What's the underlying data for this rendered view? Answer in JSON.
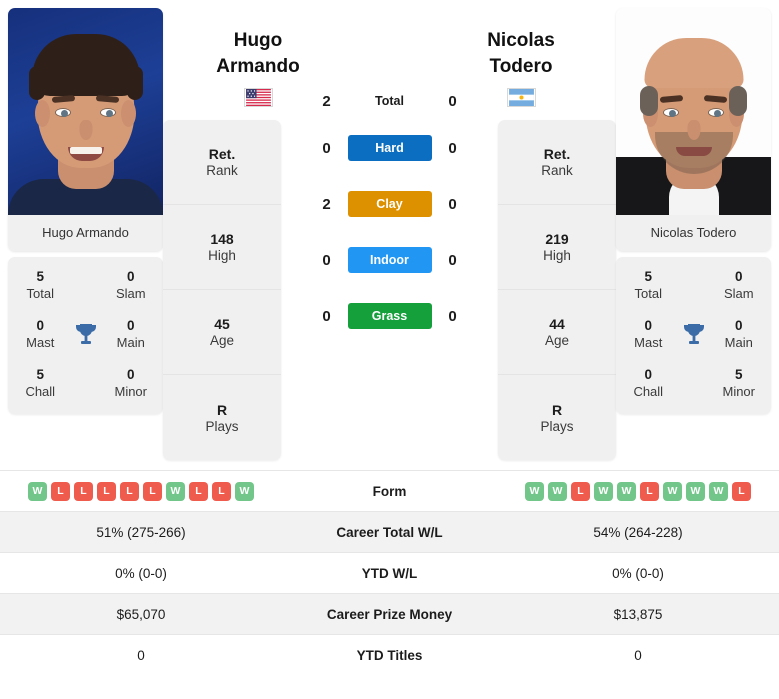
{
  "players": {
    "left": {
      "first_name": "Hugo",
      "last_name": "Armando",
      "full_name": "Hugo Armando",
      "flag": "us-flag-icon",
      "photo_name": "Hugo Armando",
      "rank": "Ret.",
      "rank_label": "Rank",
      "high": "148",
      "high_label": "High",
      "age": "45",
      "age_label": "Age",
      "plays": "R",
      "plays_label": "Plays",
      "titles": {
        "total": "5",
        "total_label": "Total",
        "slam": "0",
        "slam_label": "Slam",
        "mast": "0",
        "mast_label": "Mast",
        "main": "0",
        "main_label": "Main",
        "chall": "5",
        "chall_label": "Chall",
        "minor": "0",
        "minor_label": "Minor"
      },
      "form": [
        "W",
        "L",
        "L",
        "L",
        "L",
        "L",
        "W",
        "L",
        "L",
        "W"
      ],
      "career_total_wl": "51% (275-266)",
      "ytd_wl": "0% (0-0)",
      "career_prize_money": "$65,070",
      "ytd_titles": "0"
    },
    "right": {
      "first_name": "Nicolas",
      "last_name": "Todero",
      "full_name": "Nicolas Todero",
      "flag": "ar-flag-icon",
      "photo_name": "Nicolas Todero",
      "rank": "Ret.",
      "rank_label": "Rank",
      "high": "219",
      "high_label": "High",
      "age": "44",
      "age_label": "Age",
      "plays": "R",
      "plays_label": "Plays",
      "titles": {
        "total": "5",
        "total_label": "Total",
        "slam": "0",
        "slam_label": "Slam",
        "mast": "0",
        "mast_label": "Mast",
        "main": "0",
        "main_label": "Main",
        "chall": "0",
        "chall_label": "Chall",
        "minor": "5",
        "minor_label": "Minor"
      },
      "form": [
        "W",
        "W",
        "L",
        "W",
        "W",
        "L",
        "W",
        "W",
        "W",
        "L"
      ],
      "career_total_wl": "54% (264-228)",
      "ytd_wl": "0% (0-0)",
      "career_prize_money": "$13,875",
      "ytd_titles": "0"
    }
  },
  "head_to_head": {
    "total": {
      "label": "Total",
      "left": "2",
      "right": "0"
    },
    "surfaces": [
      {
        "label": "Hard",
        "left": "0",
        "right": "0",
        "color": "#0b6ec0"
      },
      {
        "label": "Clay",
        "left": "2",
        "right": "0",
        "color": "#dd9000"
      },
      {
        "label": "Indoor",
        "left": "0",
        "right": "0",
        "color": "#2196f3"
      },
      {
        "label": "Grass",
        "left": "0",
        "right": "0",
        "color": "#15a03c"
      }
    ]
  },
  "stats_rows": [
    {
      "label": "Form",
      "left": "",
      "right": "",
      "type": "form"
    },
    {
      "label": "Career Total W/L",
      "left": "51% (275-266)",
      "right": "54% (264-228)",
      "type": "text"
    },
    {
      "label": "YTD W/L",
      "left": "0% (0-0)",
      "right": "0% (0-0)",
      "type": "text"
    },
    {
      "label": "Career Prize Money",
      "left": "$65,070",
      "right": "$13,875",
      "type": "text"
    },
    {
      "label": "YTD Titles",
      "left": "0",
      "right": "0",
      "type": "text"
    }
  ],
  "colors": {
    "hard": "#0b6ec0",
    "clay": "#dd9000",
    "indoor": "#2196f3",
    "grass": "#15a03c",
    "win_badge": "#73c68a",
    "loss_badge": "#ef5b4c",
    "trophy": "#3b6ca8",
    "card_bg": "#f0f0f0",
    "row_alt_bg": "#f2f2f2"
  }
}
